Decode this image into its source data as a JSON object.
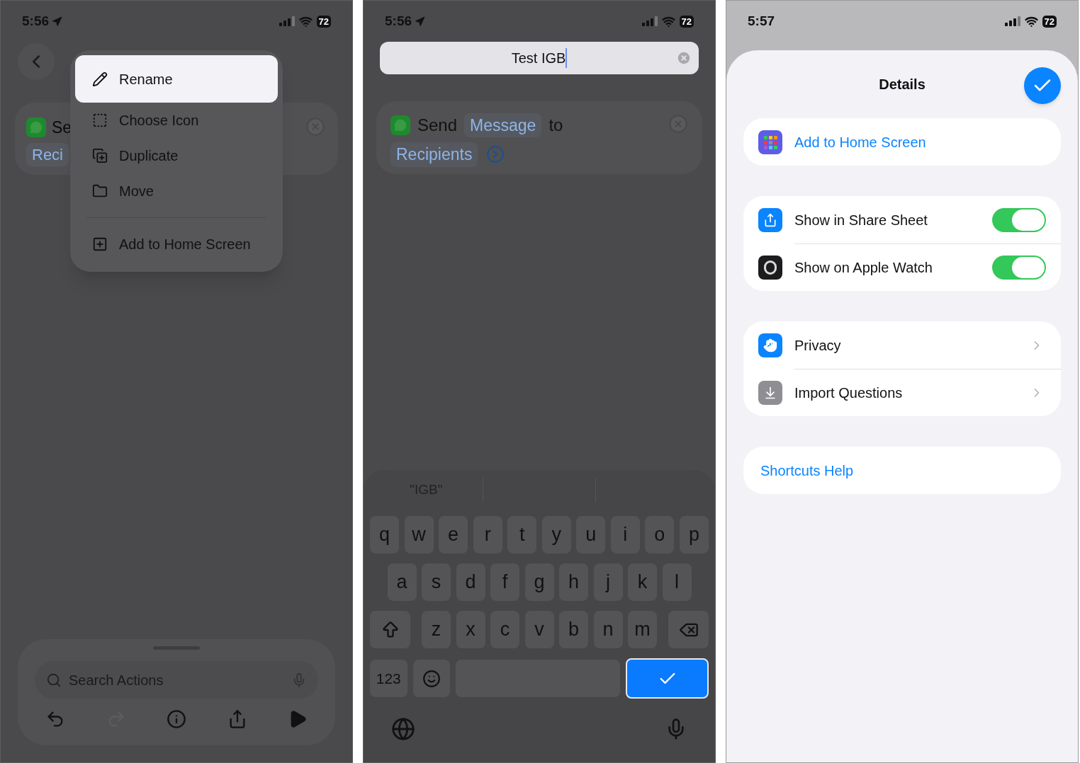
{
  "menu_screen": {
    "status": {
      "time": "5:56",
      "location": true,
      "battery": "72"
    },
    "card": {
      "title": "Se",
      "chip": "Reci"
    },
    "menu": [
      {
        "label": "Rename",
        "kind": "pencil",
        "selected": true,
        "divider_above": false
      },
      {
        "label": "Choose Icon",
        "kind": "dashed",
        "selected": false,
        "divider_above": false
      },
      {
        "label": "Duplicate",
        "kind": "duplicate",
        "selected": false,
        "divider_above": false
      },
      {
        "label": "Move",
        "kind": "folder",
        "selected": false,
        "divider_above": false
      },
      {
        "label": "Add to Home Screen",
        "kind": "plus",
        "selected": false,
        "divider_above": true
      }
    ],
    "search": {
      "placeholder": "Search Actions"
    },
    "toolbar": [
      {
        "kind": "undo",
        "disabled": false
      },
      {
        "kind": "redo",
        "disabled": true
      },
      {
        "kind": "info",
        "disabled": false
      },
      {
        "kind": "share",
        "disabled": false
      },
      {
        "kind": "play",
        "disabled": false
      }
    ]
  },
  "rename_screen": {
    "status": {
      "time": "5:56",
      "location": true,
      "battery": "72"
    },
    "name_field": {
      "value": "Test IGB"
    },
    "action": {
      "verb": "Send",
      "param": "Message",
      "joiner": "to",
      "recipients": "Recipients"
    },
    "suggestions": [
      "\"IGB\""
    ],
    "keyboard": {
      "rows": [
        [
          "q",
          "w",
          "e",
          "r",
          "t",
          "y",
          "u",
          "i",
          "o",
          "p"
        ],
        [
          "a",
          "s",
          "d",
          "f",
          "g",
          "h",
          "j",
          "k",
          "l"
        ],
        [
          "z",
          "x",
          "c",
          "v",
          "b",
          "n",
          "m"
        ]
      ],
      "numbers_key": "123"
    }
  },
  "details_screen": {
    "status": {
      "time": "5:57",
      "location": false,
      "battery": "72"
    },
    "title": "Details",
    "add_home": "Add to Home Screen",
    "toggles": [
      {
        "label": "Show in Share Sheet",
        "kind": "share",
        "on": true
      },
      {
        "label": "Show on Apple Watch",
        "kind": "watch",
        "on": true
      }
    ],
    "links": [
      {
        "label": "Privacy",
        "kind": "hand"
      },
      {
        "label": "Import Questions",
        "kind": "import"
      }
    ],
    "help": "Shortcuts Help"
  }
}
